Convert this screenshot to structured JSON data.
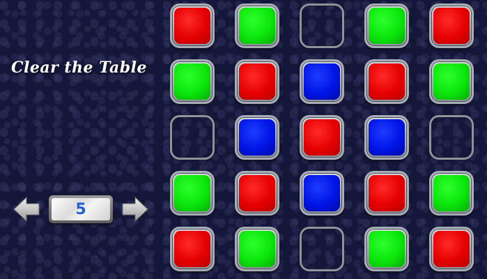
{
  "title": "Clear the Table",
  "level": {
    "value": "5",
    "prev_icon": "arrow-left-icon",
    "next_icon": "arrow-right-icon"
  },
  "colors": {
    "red": "#e60000",
    "green": "#0be60b",
    "blue": "#0014e6",
    "frame": "#a9aeb6",
    "background": "#15173a",
    "level_text": "#1f5fcf"
  },
  "board": [
    [
      "red",
      "green",
      "empty",
      "green",
      "red"
    ],
    [
      "green",
      "red",
      "blue",
      "red",
      "green"
    ],
    [
      "empty",
      "blue",
      "red",
      "blue",
      "empty"
    ],
    [
      "green",
      "red",
      "blue",
      "red",
      "green"
    ],
    [
      "red",
      "green",
      "empty",
      "green",
      "red"
    ]
  ]
}
